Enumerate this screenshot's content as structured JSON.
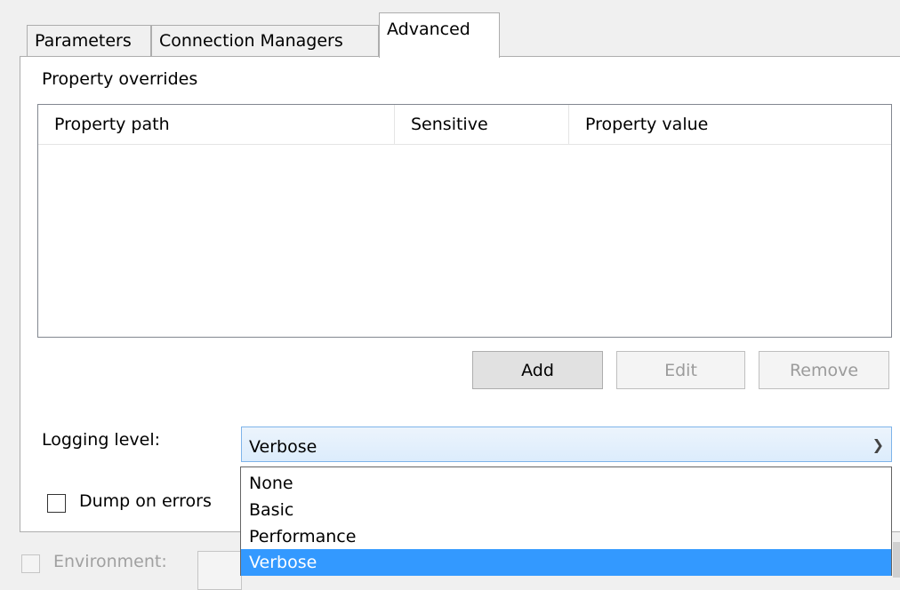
{
  "tabs": [
    {
      "label": "Parameters"
    },
    {
      "label": "Connection Managers"
    },
    {
      "label": "Advanced"
    }
  ],
  "property_overrides": {
    "title": "Property overrides",
    "columns": [
      "Property path",
      "Sensitive",
      "Property value"
    ],
    "rows": []
  },
  "buttons": {
    "add": "Add",
    "edit": "Edit",
    "remove": "Remove"
  },
  "logging": {
    "label": "Logging level:",
    "selected": "Verbose",
    "options": [
      "None",
      "Basic",
      "Performance",
      "Verbose"
    ]
  },
  "dump_on_errors": {
    "label": "Dump on errors",
    "checked": false
  },
  "environment": {
    "label": "Environment:",
    "checked": false,
    "enabled": false
  },
  "colors": {
    "selection": "#3399ff",
    "combo_border": "#7eb4ea"
  }
}
